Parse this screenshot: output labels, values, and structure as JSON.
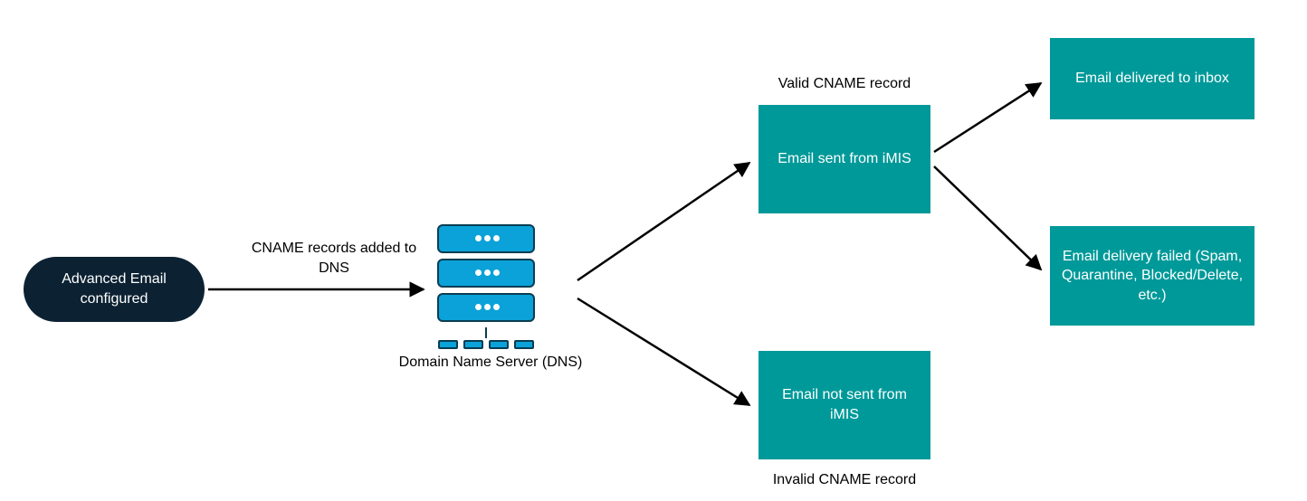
{
  "nodes": {
    "start": {
      "text": "Advanced Email configured"
    },
    "dns": {
      "caption": "Domain Name Server (DNS)"
    },
    "valid": {
      "label": "Valid CNAME record",
      "text": "Email sent from iMIS"
    },
    "invalid": {
      "label": "Invalid CNAME record",
      "text": "Email not sent from iMIS"
    },
    "delivered": {
      "text": "Email delivered to inbox"
    },
    "failed": {
      "text": "Email delivery failed (Spam, Quarantine, Blocked/Delete, etc.)"
    }
  },
  "edges": {
    "start_to_dns": {
      "label": "CNAME records added to DNS"
    }
  },
  "colors": {
    "start_bg": "#0c2233",
    "box_bg": "#009999",
    "server_fill": "#0aa2d8",
    "server_stroke": "#0a3d52"
  }
}
